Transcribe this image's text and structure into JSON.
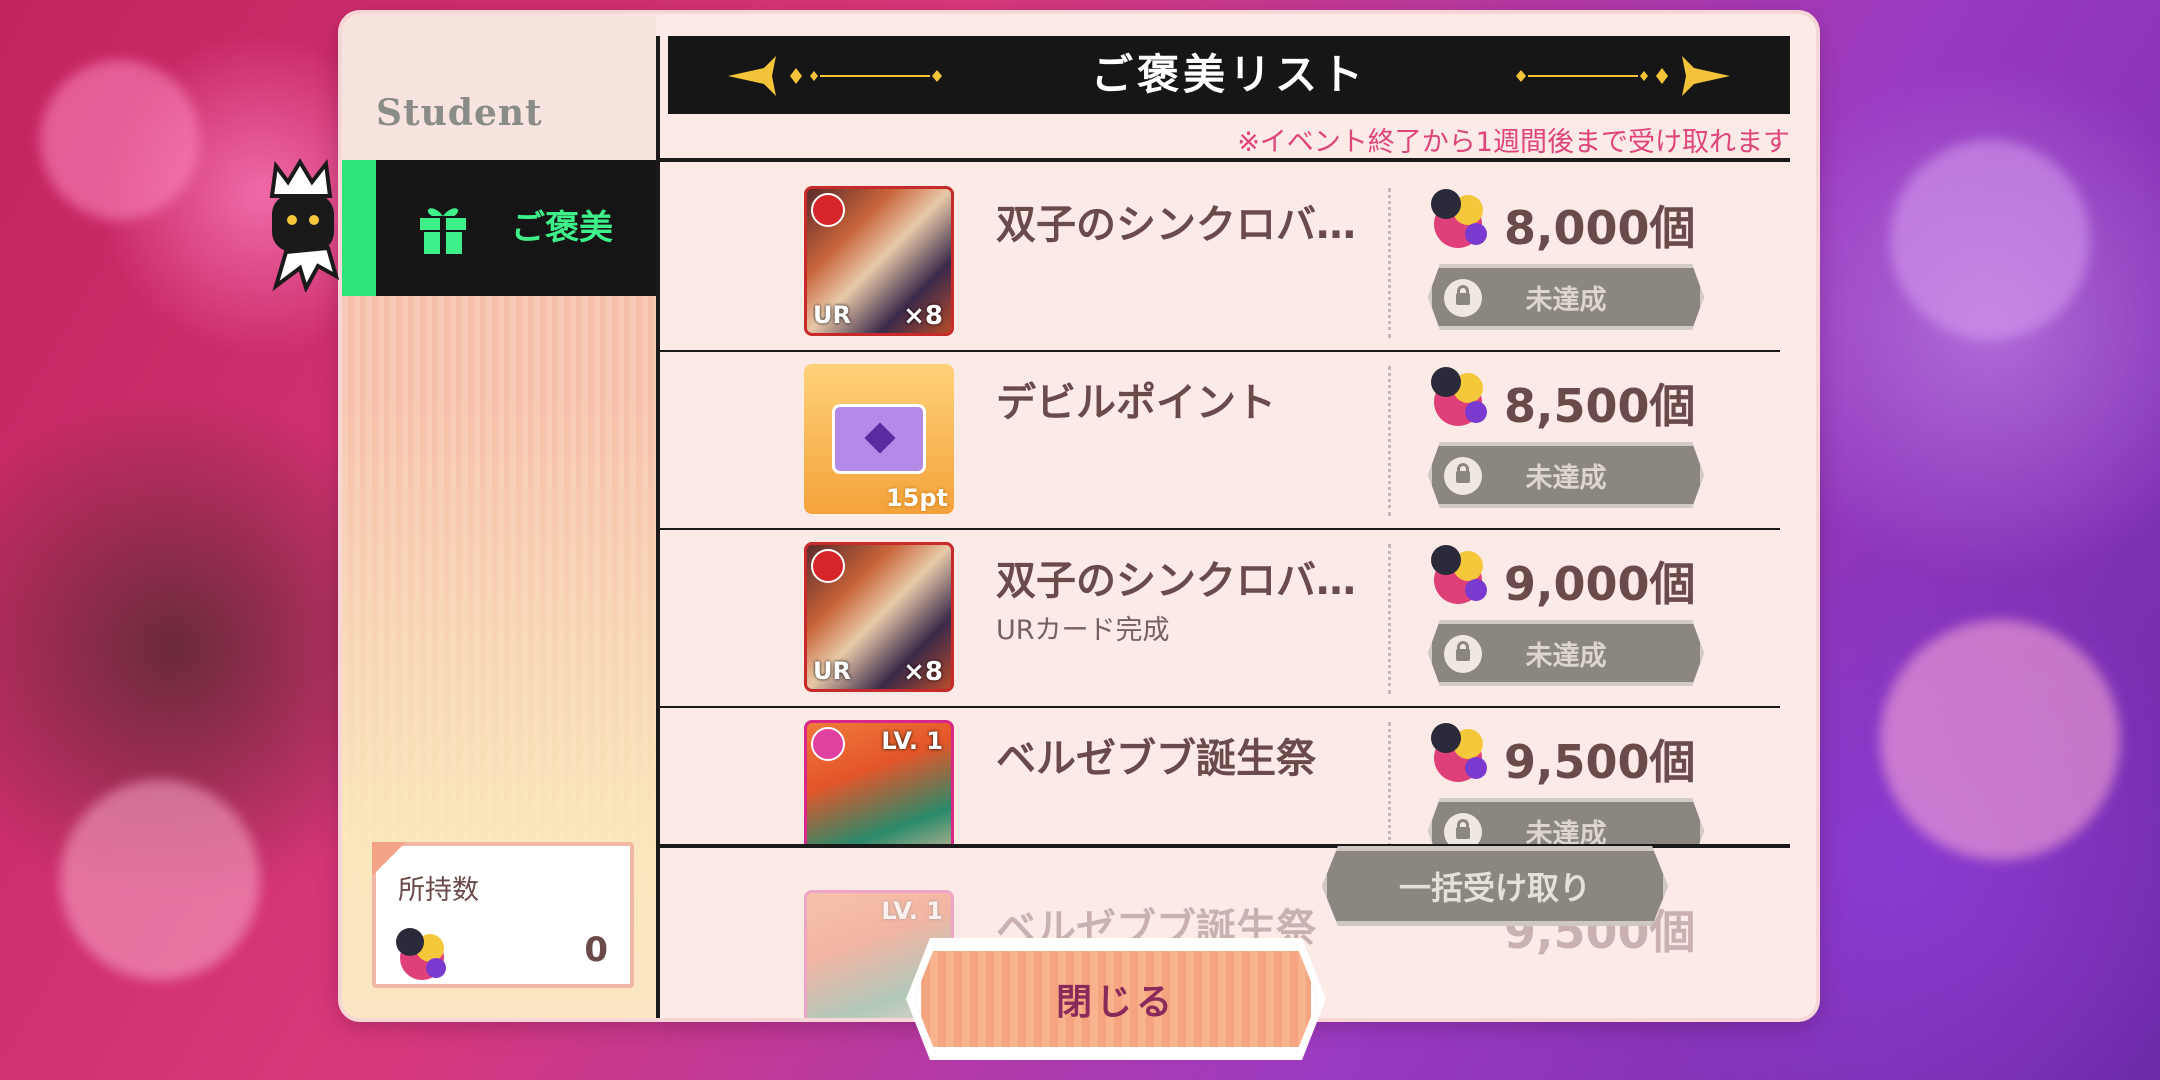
{
  "sidebar": {
    "logo": "Student",
    "tab_label": "ご褒美",
    "owned_label": "所持数",
    "owned_count": "0"
  },
  "header": {
    "title": "ご褒美リスト",
    "notice": "※イベント終了から1週間後まで受け取れます"
  },
  "rewards": [
    {
      "name": "双子のシンクロバ…",
      "sub": "",
      "required": "8,000個",
      "status": "未達成",
      "thumb_rarity": "UR",
      "thumb_qty": "×8"
    },
    {
      "name": "デビルポイント",
      "sub": "",
      "required": "8,500個",
      "status": "未達成",
      "thumb_pt": "15pt"
    },
    {
      "name": "双子のシンクロバ…",
      "sub": "URカード完成",
      "required": "9,000個",
      "status": "未達成",
      "thumb_rarity": "UR",
      "thumb_qty": "×8"
    },
    {
      "name": "ベルゼブブ誕生祭",
      "sub": "",
      "required": "9,500個",
      "status": "未達成",
      "thumb_lv": "LV. 1"
    }
  ],
  "ghost_row": {
    "name": "ベルゼブブ誕生祭",
    "required": "9,500個",
    "thumb_lv": "LV. 1"
  },
  "buttons": {
    "bulk_receive": "一括受け取り",
    "close": "閉じる"
  },
  "colors": {
    "accent_green": "#2ee57a",
    "notice_pink": "#e0457a",
    "disabled_button": "#8c8680",
    "close_button": "#f8b28e"
  }
}
